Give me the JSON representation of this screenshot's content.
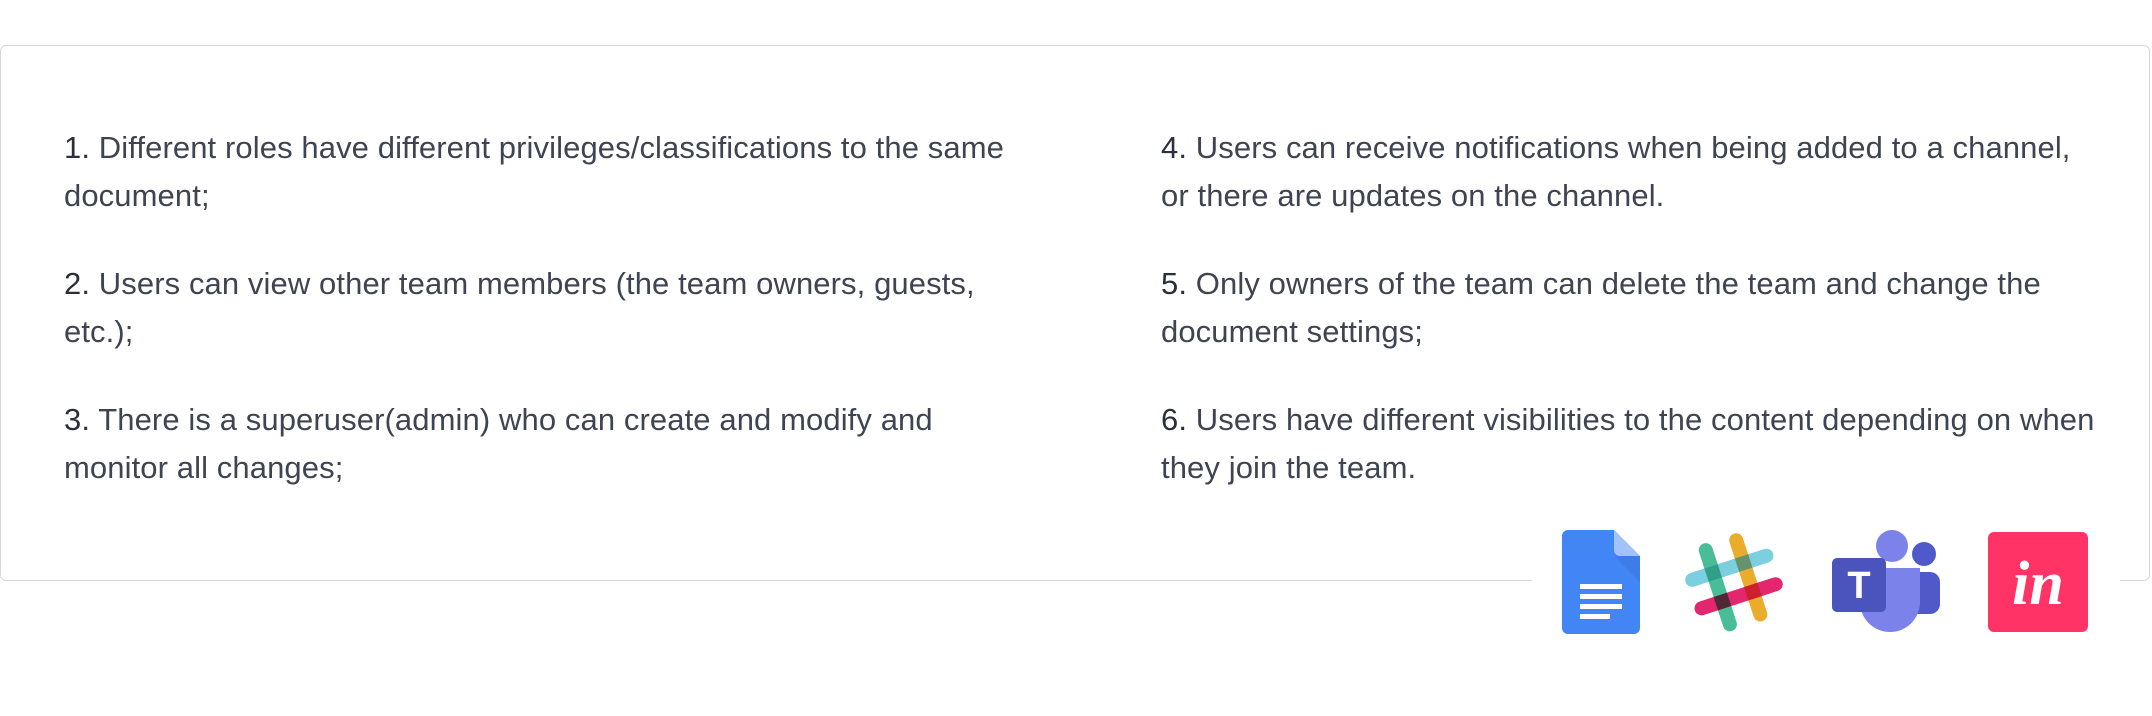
{
  "requirements": {
    "left": [
      {
        "num": "1.",
        "text": " Different roles have different privileges/classifications to the same document;"
      },
      {
        "num": "2.",
        "text": " Users can view other team members (the team owners, guests, etc.);"
      },
      {
        "num": "3.",
        "text": " There is a superuser(admin) who can create and modify and monitor all changes;"
      }
    ],
    "right": [
      {
        "num": "4.",
        "text": " Users can receive notifications when being added to a channel, or there are updates on the channel."
      },
      {
        "num": "5.",
        "text": " Only owners of the team can delete the team and change the document settings;"
      },
      {
        "num": "6.",
        "text": " Users have different visibilities to the content depending on when they join the team."
      }
    ]
  },
  "app_icons": {
    "docs": "google-docs-icon",
    "slack": "slack-icon",
    "teams": "microsoft-teams-icon",
    "invision": "invision-icon",
    "teams_letter": "T",
    "invision_letters": "in"
  },
  "colors": {
    "text": "#3f4452",
    "border": "#d6d8dc",
    "docs_blue": "#4285f4",
    "teams_purple": "#5059c9",
    "invision_pink": "#ff3366"
  }
}
